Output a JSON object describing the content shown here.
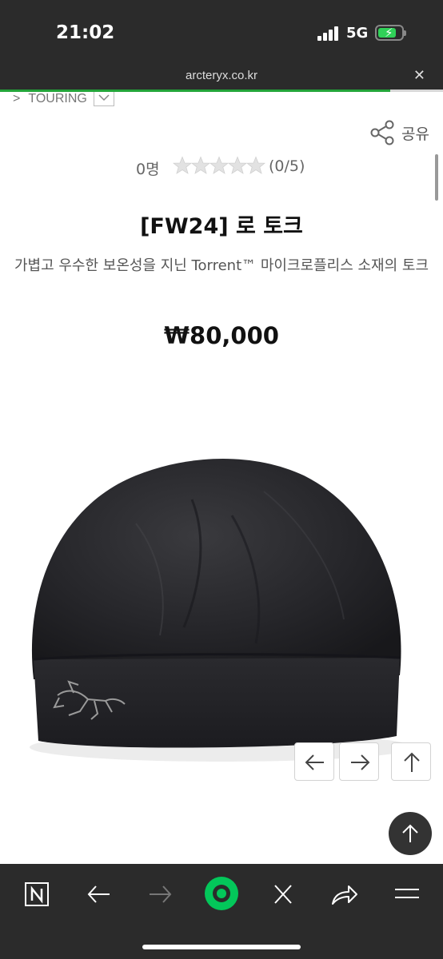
{
  "status_bar": {
    "time": "21:02",
    "network": "5G",
    "battery_charging": true,
    "signal_bars": 4,
    "accent_color": "#30d158"
  },
  "browser": {
    "url": "arcteryx.co.kr",
    "load_progress": 0.88,
    "progress_color": "#23a43a",
    "close_icon": "close-icon"
  },
  "breadcrumb": {
    "label": "TOURING",
    "dropdown_icon": "chevron-down-icon"
  },
  "share": {
    "label": "공유",
    "icon": "share-icon"
  },
  "rating": {
    "count": "0명",
    "score": "(0/5)",
    "stars_filled": 0,
    "stars_total": 5
  },
  "product": {
    "title": "[FW24] 로 토크",
    "description": "가볍고 우수한 보온성을 지닌 Torrent™ 마이크로플리스 소재의 토크",
    "price": "₩80,000",
    "image_alt": "black beanie with grey Arc'teryx logo"
  },
  "image_nav": {
    "prev_icon": "arrow-left-icon",
    "next_icon": "arrow-right-icon",
    "top_icon": "arrow-up-icon"
  },
  "toolbar": {
    "items": [
      "naver-home-icon",
      "back-icon",
      "forward-icon",
      "green-dot-icon",
      "close-icon",
      "share-icon",
      "menu-icon"
    ],
    "accent_color": "#03c75a"
  }
}
